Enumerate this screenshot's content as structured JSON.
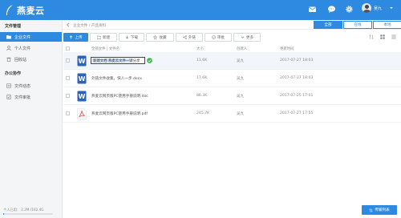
{
  "app": {
    "name": "燕麦云",
    "user_name": "吴九",
    "brand_color": "#2d8ae0"
  },
  "sidebar": {
    "groups": [
      {
        "title": "文件管理",
        "items": [
          {
            "label": "企业文件",
            "icon": "folder-icon",
            "active": true
          },
          {
            "label": "个人文件",
            "icon": "user-icon",
            "active": false
          },
          {
            "label": "回收站",
            "icon": "trash-icon",
            "active": false
          }
        ]
      },
      {
        "title": "办公协作",
        "items": [
          {
            "label": "文件动态",
            "icon": "activity-icon",
            "active": false
          },
          {
            "label": "文件审批",
            "icon": "approval-icon",
            "active": false
          }
        ]
      }
    ],
    "storage": {
      "label": "个人已用： 2.2M /162.4G",
      "used_fraction": 0.02
    }
  },
  "breadcrumb": {
    "text": "企业文件 / 产品资料"
  },
  "scope_tabs": [
    {
      "label": "全部",
      "active": true
    },
    {
      "label": "在线",
      "active": false
    },
    {
      "label": "本地",
      "active": false
    }
  ],
  "toolbar": {
    "upload": "上传",
    "new": "新建",
    "download": "下载",
    "favorite": "收藏",
    "share": "外链",
    "approve": "审批",
    "more": "更多"
  },
  "table": {
    "columns": {
      "name": "全部文件 | 文件名",
      "size": "大小",
      "owner": "创建人",
      "time": "更新时间"
    },
    "rows": [
      {
        "name": "新建文档 燕麦云文件一键分享.docx",
        "editing_text": "新建文档 燕麦云文件一键分享",
        "type": "word",
        "size": "11.6K",
        "owner": "吴九",
        "time": "2017-07-27 18:03",
        "editing": true
      },
      {
        "name": "外链文件收集，快人一步.docx",
        "type": "word",
        "size": "17.6K",
        "owner": "吴九",
        "time": "2017-07-27 18:03",
        "editing": false
      },
      {
        "name": "燕麦云网页版PC使用手册说明.doc",
        "type": "word",
        "size": "86.3K",
        "owner": "吴九",
        "time": "2017-07-25 17:01",
        "editing": false
      },
      {
        "name": "燕麦云网页版PC使用手册说明.pdf",
        "type": "pdf",
        "size": "245.7K",
        "owner": "吴九",
        "time": "2017-07-27 17:55",
        "editing": false
      }
    ]
  },
  "transfer": {
    "label": "传输列表"
  }
}
